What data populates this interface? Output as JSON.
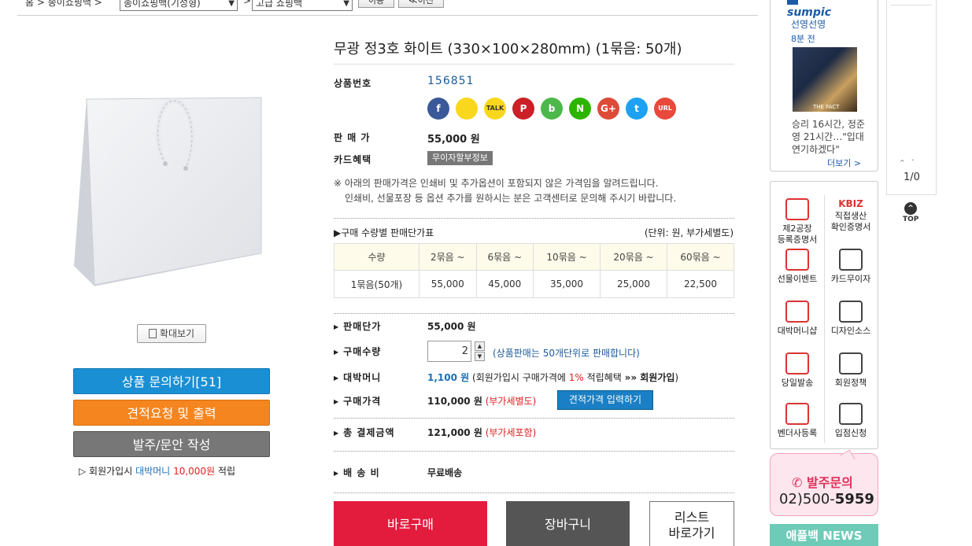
{
  "breadcrumb": {
    "home": "홈 >",
    "cat1_text": "종이쇼핑백 >",
    "select1": "종이쇼핑백(기성형)",
    "sep": ">",
    "select2": "고급 쇼핑백",
    "move_btn": "이동",
    "prev_btn": "≪이전"
  },
  "product": {
    "title": "무광 정3호 화이트 (330×100×280mm) (1묶음: 50개)",
    "zoom_label": "확대보기",
    "inquiry_btn": "상품 문의하기[51]",
    "quote_btn": "견적요청 및 출력",
    "order_btn": "발주/문안 작성",
    "reward_note": {
      "prefix": "▷  회원가입시 ",
      "money_label": "대박머니",
      "amount": "10,000원",
      "suffix": " 적립"
    }
  },
  "info": {
    "product_no_label": "상품번호",
    "product_no": "156851",
    "price_label": "판 매 가",
    "price": "55,000 원",
    "card_label": "카드혜택",
    "card_badge": "무이자할부정보",
    "notice_line1": "※ 아래의 판매가격은 인쇄비 및 추가옵션이 포함되지 않은 가격임을 알려드립니다.",
    "notice_line2": "인쇄비, 선물포장 등 옵션 추가를 원하시는 분은 고객센터로 문의해 주시기 바랍니다.",
    "share_icons": [
      {
        "name": "facebook-icon",
        "glyph": "f",
        "color": "#3b5998"
      },
      {
        "name": "kakaostory-icon",
        "glyph": "",
        "color": "#f9d71c"
      },
      {
        "name": "kakaotalk-icon",
        "glyph": "TALK",
        "color": "#f9d71c"
      },
      {
        "name": "pinterest-icon",
        "glyph": "P",
        "color": "#cb2027"
      },
      {
        "name": "band-icon",
        "glyph": "b",
        "color": "#4cb84b"
      },
      {
        "name": "naver-icon",
        "glyph": "N",
        "color": "#2db400"
      },
      {
        "name": "googleplus-icon",
        "glyph": "G+",
        "color": "#dd4b39"
      },
      {
        "name": "twitter-icon",
        "glyph": "t",
        "color": "#1da1f2"
      },
      {
        "name": "url-icon",
        "glyph": "URL",
        "color": "#e8493a"
      }
    ]
  },
  "qty_table": {
    "title": "▶구매 수량별 판매단가표",
    "unit": "(단위: 원, 부가세별도)",
    "headers": [
      "수량",
      "2묶음 ~",
      "6묶음 ~",
      "10묶음 ~",
      "20묶음 ~",
      "60묶음 ~"
    ],
    "row": [
      "1묶음(50개)",
      "55,000",
      "45,000",
      "35,000",
      "25,000",
      "22,500"
    ]
  },
  "order": {
    "unit_price_label": "판매단가",
    "unit_price": "55,000 원",
    "qty_label": "구매수량",
    "qty_value": "2",
    "qty_note": "(상품판매는 50개단위로 판매합니다)",
    "bonus_label": "대박머니",
    "bonus_amount": "1,100 원",
    "bonus_note_1": "(회원가입시 구매가격에 ",
    "bonus_pct": "1%",
    "bonus_note_2": " 적립혜택 ",
    "bonus_link": "»» 회원가입",
    "bonus_close": ")",
    "buy_price_label": "구매가격",
    "buy_price": "110,000 원",
    "buy_price_note": "(부가세별도)",
    "estimate_btn": "견적가격 입력하기",
    "total_label": "총 결제금액",
    "total": "121,000 원",
    "total_note": "(부가세포함)",
    "ship_label": "배 송 비",
    "ship_value": "무료배송",
    "buy_now": "바로구매",
    "cart": "장바구니",
    "list_back_1": "리스트",
    "list_back_2": "바로가기"
  },
  "sidebar": {
    "news_logo": "sumpic",
    "news_source": "선영선영",
    "news_time": "8분 전",
    "news_photo_caption": "THE FACT",
    "news_headline": "승리 16시간, 정준영 21시간…\"입대 연기하겠다\"",
    "news_more": "더보기 >",
    "pager": "1/0",
    "top": "TOP",
    "quick_items": [
      {
        "line1": "제2공장",
        "line2": "등록증명서",
        "icon": "factory-icon"
      },
      {
        "line1": "KBIZ",
        "line2": "직접생산",
        "line3": "확인증명서",
        "icon": "kbiz-logo"
      },
      {
        "line1": "선물이벤트",
        "icon": "gift-icon"
      },
      {
        "line1": "카드무이자",
        "icon": "card-icon"
      },
      {
        "line1": "대박머니샵",
        "icon": "money-shop-icon"
      },
      {
        "line1": "디자인소스",
        "icon": "design-source-icon"
      },
      {
        "line1": "당일발송",
        "icon": "truck-icon"
      },
      {
        "line1": "회원정책",
        "icon": "member-icon"
      },
      {
        "line1": "벤더사등록",
        "icon": "handshake-icon"
      },
      {
        "line1": "입점신청",
        "icon": "store-icon"
      }
    ],
    "phone_label": "발주문의",
    "phone_prefix": "02)500-",
    "phone_suffix": "5959",
    "news_banner": "애플백 NEWS"
  }
}
